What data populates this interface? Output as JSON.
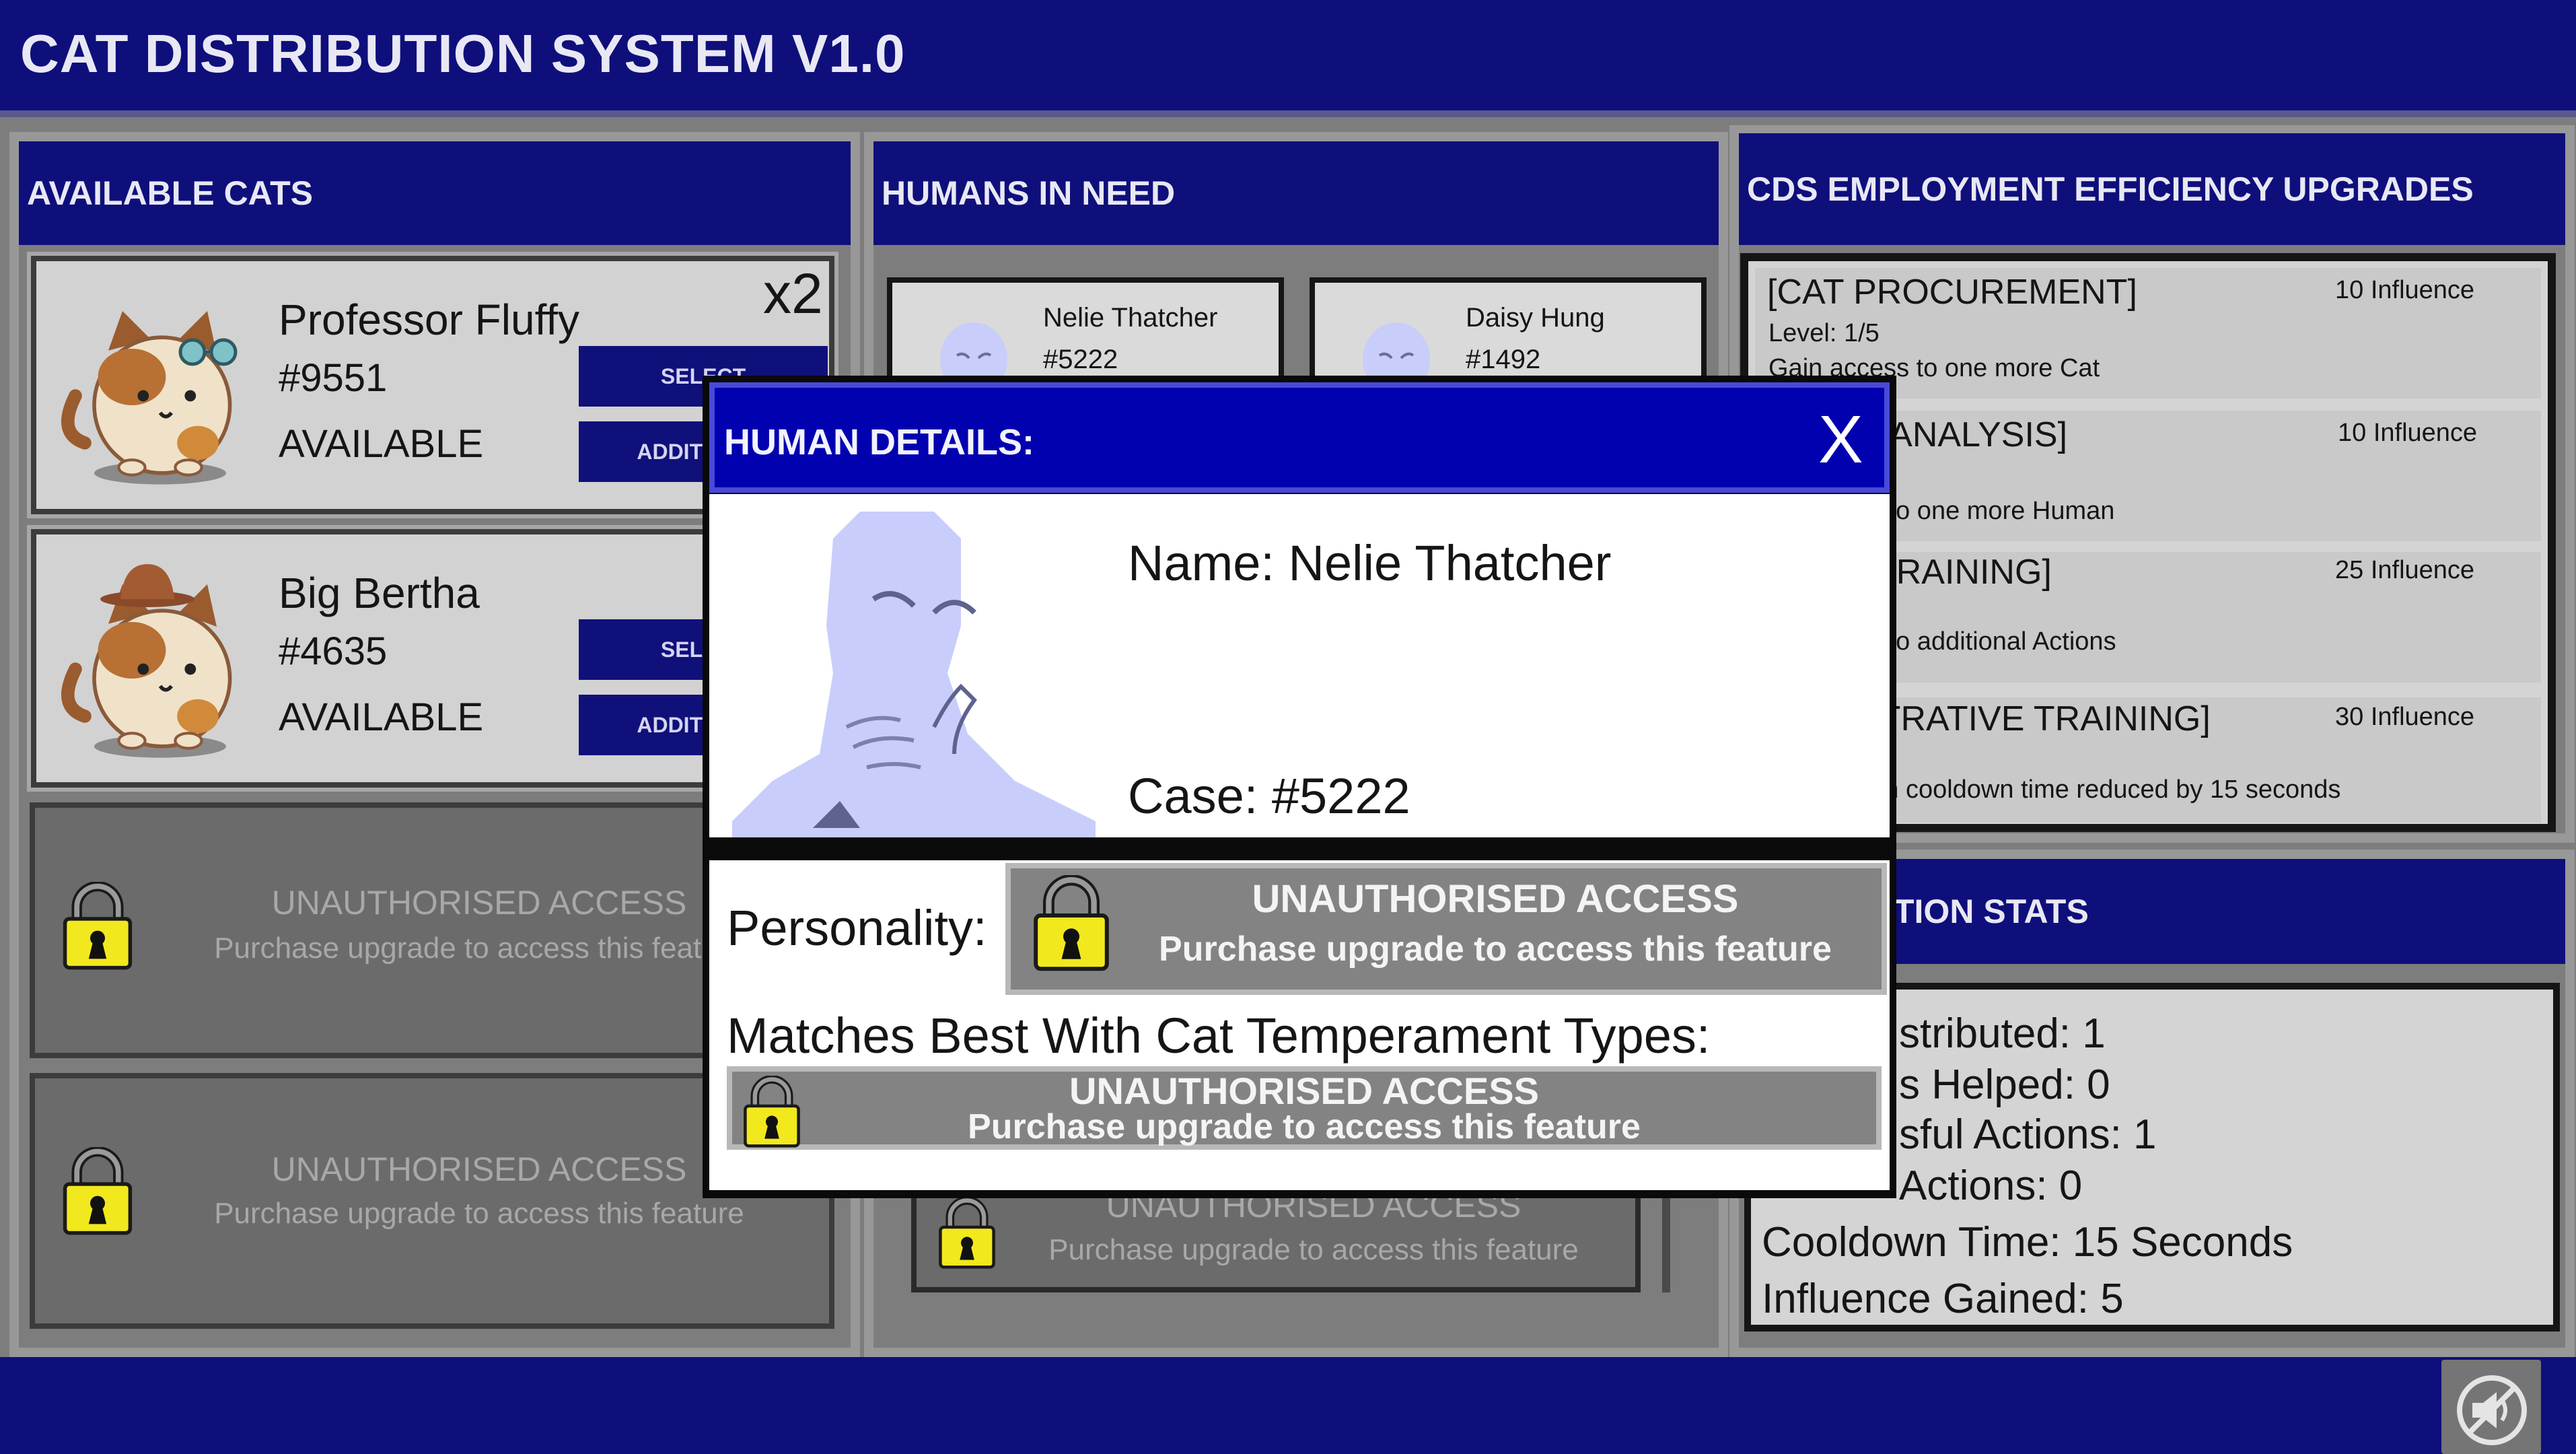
{
  "app": {
    "title": "CAT DISTRIBUTION SYSTEM V1.0"
  },
  "cats_panel": {
    "header": "AVAILABLE CATS",
    "multiplier": "x2",
    "cats": [
      {
        "name": "Professor Fluffy",
        "id": "#9551",
        "status": "AVAILABLE",
        "select_label": "SELECT",
        "additional_label": "ADDITIONAL"
      },
      {
        "name": "Big Bertha",
        "id": "#4635",
        "status": "AVAILABLE",
        "select_label": "SELECT",
        "additional_label": "ADDITIONAL"
      }
    ],
    "locked": [
      {
        "line1": "UNAUTHORISED ACCESS",
        "line2": "Purchase upgrade to access this feature"
      },
      {
        "line1": "UNAUTHORISED ACCESS",
        "line2": "Purchase upgrade to access this feature"
      }
    ]
  },
  "humans_panel": {
    "header": "HUMANS IN NEED",
    "humans": [
      {
        "name": "Nelie Thatcher",
        "case": "#5222"
      },
      {
        "name": "Daisy Hung",
        "case": "#1492"
      }
    ],
    "locked": {
      "line1": "UNAUTHORISED ACCESS",
      "line2": "Purchase upgrade to access this feature"
    }
  },
  "upgrades_panel": {
    "header": "CDS EMPLOYMENT EFFICIENCY UPGRADES",
    "items": [
      {
        "title": "[CAT PROCUREMENT]",
        "cost": "10 Influence",
        "level": "Level: 1/5",
        "desc": "Gain access to one more Cat"
      },
      {
        "title": "N ANALYSIS]",
        "cost": "10 Influence",
        "level": "",
        "desc": "ss to one more Human"
      },
      {
        "title": "I TRAINING]",
        "cost": "25 Influence",
        "level": "",
        "desc": "ss to additional Actions"
      },
      {
        "title": "STRATIVE TRAINING]",
        "cost": "30 Influence",
        "level": "",
        "desc": "nan cooldown time reduced by 15 seconds"
      }
    ]
  },
  "stats_panel": {
    "header": "TION STATS",
    "lines": [
      "stributed: 1",
      "s Helped: 0",
      "sful Actions: 1",
      "Actions: 0",
      "Cooldown Time: 15 Seconds",
      "Influence Gained: 5"
    ]
  },
  "modal": {
    "title": "HUMAN DETAILS:",
    "close_label": "X",
    "name_line": "Name: Nelie Thatcher",
    "case_line": "Case: #5222",
    "personality_label": "Personality:",
    "personality_locked": {
      "line1": "UNAUTHORISED ACCESS",
      "line2": "Purchase upgrade to access this feature"
    },
    "matches_label": "Matches Best With Cat Temperament Types:",
    "matches_locked": {
      "line1": "UNAUTHORISED ACCESS",
      "line2": "Purchase upgrade to access this feature"
    }
  },
  "colors": {
    "navy": "#0f0f7c",
    "modal_header": "#0101b0",
    "lock_yellow": "#f2e81e"
  },
  "icons": [
    "cat-icon",
    "padlock-icon",
    "human-silhouette-icon",
    "mute-speaker-icon",
    "close-icon"
  ]
}
